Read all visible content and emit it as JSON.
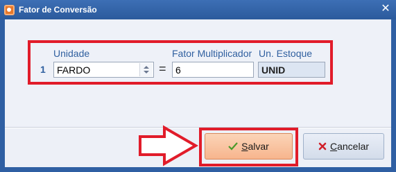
{
  "window": {
    "title": "Fator de Conversão"
  },
  "form": {
    "row_number": "1",
    "unidade_label": "Unidade",
    "unidade_value": "FARDO",
    "equals": "=",
    "fator_label": "Fator Multiplicador",
    "fator_value": "6",
    "estoque_label": "Un. Estoque",
    "estoque_value": "UNID"
  },
  "buttons": {
    "salvar_hotkey": "S",
    "salvar_rest": "alvar",
    "cancelar_hotkey": "C",
    "cancelar_rest": "ancelar"
  },
  "colors": {
    "highlight": "#e11c2a",
    "accent": "#2f5fa3"
  },
  "icons": {
    "salvar": "check-icon",
    "cancelar": "x-icon",
    "app": "app-icon"
  }
}
